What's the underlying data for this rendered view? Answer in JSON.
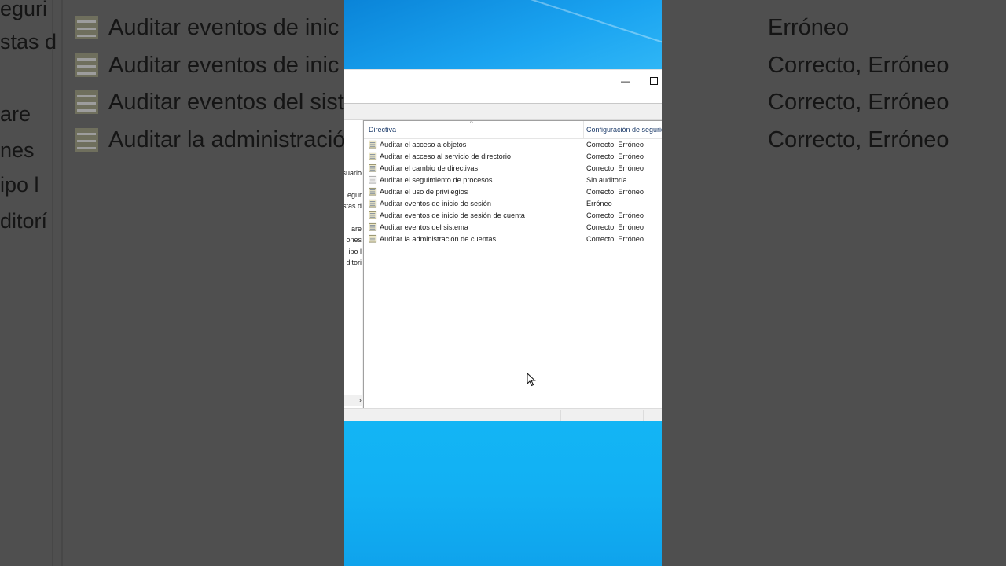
{
  "background": {
    "rows": [
      {
        "text": "Auditar eventos de inic",
        "setting": "Erróneo"
      },
      {
        "text": "Auditar eventos de inic",
        "setting": "Correcto, Erróneo"
      },
      {
        "text": "Auditar eventos del sist",
        "setting": "Correcto, Erróneo"
      },
      {
        "text": "Auditar la administració",
        "setting": "Correcto, Erróneo"
      }
    ],
    "left_fragments": [
      "eguri",
      "stas d",
      "are",
      "nes",
      "ipo l",
      "ditorí"
    ]
  },
  "window": {
    "minimize_glyph": "—",
    "tree_fragments": [
      "suario",
      "egur",
      "stas d",
      "are",
      "ones",
      "ipo l",
      "ditori"
    ],
    "tree_scroll_glyph": "›",
    "columns": {
      "policy": "Directiva",
      "setting": "Configuración de seguridad"
    },
    "sort_glyph": "^",
    "rows": [
      {
        "name": "Auditar el acceso a objetos",
        "value": "Correcto, Erróneo",
        "icon": "policy-icon"
      },
      {
        "name": "Auditar el acceso al servicio de directorio",
        "value": "Correcto, Erróneo",
        "icon": "policy-icon"
      },
      {
        "name": "Auditar el cambio de directivas",
        "value": "Correcto, Erróneo",
        "icon": "policy-icon"
      },
      {
        "name": "Auditar el seguimiento de procesos",
        "value": "Sin auditoría",
        "icon": "policy-disabled-icon"
      },
      {
        "name": "Auditar el uso de privilegios",
        "value": "Correcto, Erróneo",
        "icon": "policy-icon"
      },
      {
        "name": "Auditar eventos de inicio de sesión",
        "value": "Erróneo",
        "icon": "policy-icon"
      },
      {
        "name": "Auditar eventos de inicio de sesión de cuenta",
        "value": "Correcto, Erróneo",
        "icon": "policy-icon"
      },
      {
        "name": "Auditar eventos del sistema",
        "value": "Correcto, Erróneo",
        "icon": "policy-icon"
      },
      {
        "name": "Auditar la administración de cuentas",
        "value": "Correcto, Erróneo",
        "icon": "policy-icon"
      }
    ]
  },
  "colors": {
    "desktop": "#0fa6ee",
    "header_text": "#1e3d6b",
    "background_overlay": "#4f4f4f"
  }
}
